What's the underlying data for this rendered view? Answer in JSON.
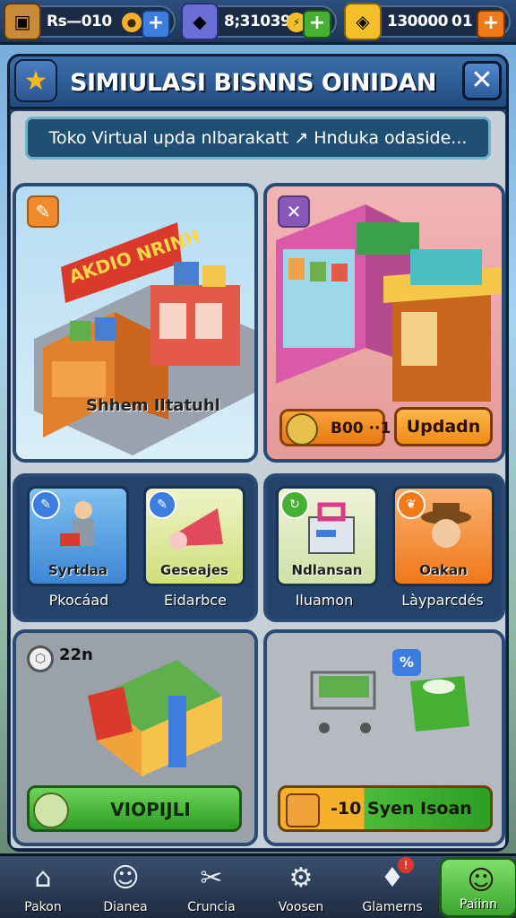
{
  "resources": [
    {
      "value": "Rs—010",
      "icon": "chest-icon",
      "accent": "#f4b02a"
    },
    {
      "value": "8;310391",
      "icon": "gem-cube-icon",
      "accent": "#45b034"
    },
    {
      "value": "130000",
      "extra": "01",
      "icon": "gold-coin-icon",
      "accent": "#f07a1a"
    }
  ],
  "window": {
    "title": "SIMIULASI BISNNS OINIDAN",
    "close": "✕",
    "banner": "Toko Virtual upda nlbarakatt ↗ Hnduka odaside..."
  },
  "shops": {
    "left": {
      "sign1": "AKDIO NRINH",
      "label": "Shhem Iltatuhl"
    },
    "right": {
      "price": "B00 ··1",
      "upgrade": "Updadn"
    }
  },
  "tiles": [
    {
      "label": "Syrtdaa",
      "sub": "Pkocáad"
    },
    {
      "label": "Geseajes",
      "sub": "Eidarbce"
    },
    {
      "label": "Ndlansan",
      "sub": "Iluamon"
    },
    {
      "label": "Oakan",
      "sub": "Làyparcdés"
    }
  ],
  "bottom": {
    "left": {
      "count": "22n",
      "button": "VIOPIJLI"
    },
    "right": {
      "button": "-10  Syen  Isoan"
    }
  },
  "nav": [
    {
      "label": "Pakon",
      "icon": "home-icon"
    },
    {
      "label": "Dianea",
      "icon": "farmer-avatar-icon"
    },
    {
      "label": "Cruncia",
      "icon": "tools-icon"
    },
    {
      "label": "Voosen",
      "icon": "gear-icon"
    },
    {
      "label": "Glamerns",
      "icon": "gift-card-icon"
    },
    {
      "label": "Paiinn",
      "icon": "farmer-avatar-icon"
    }
  ]
}
